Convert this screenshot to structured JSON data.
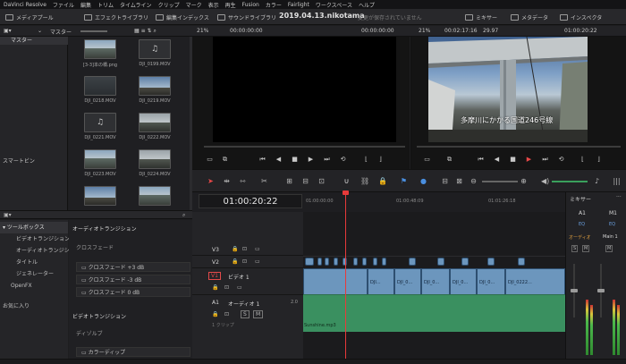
{
  "menu": [
    "DaVinci Resolve",
    "ファイル",
    "編集",
    "トリム",
    "タイムライン",
    "クリップ",
    "マーク",
    "表示",
    "再生",
    "Fusion",
    "カラー",
    "Fairlight",
    "ワークスペース",
    "ヘルプ"
  ],
  "toolbar": {
    "media_pool": "メディアプール",
    "effects_library": "エフェクトライブラリ",
    "edit_index": "編集インデックス",
    "sound_library": "サウンドライブラリ",
    "project_title": "2019.04.13.nikotama",
    "status": "変更が保存されていません",
    "mixer": "ミキサー",
    "metadata": "メタデータ",
    "inspector": "インスペクタ"
  },
  "bar2": {
    "bin": "マスター",
    "source_zoom": "21%",
    "source_tc": "00:00:00:00",
    "source_dur": "00:00:00:00",
    "tl_zoom": "21%",
    "tl_dur": "00:02:17:16",
    "fps": "29.97",
    "tl_tc": "01:00:20:22"
  },
  "bins": {
    "master": "マスター",
    "smart": "スマートビン"
  },
  "clips": [
    {
      "name": "[3-3]本の橋.png",
      "kind": "street"
    },
    {
      "name": "DJI_0199.MOV",
      "kind": "audio"
    },
    {
      "name": "DJI_0218.MOV",
      "kind": "dark"
    },
    {
      "name": "DJI_0219.MOV",
      "kind": "sky"
    },
    {
      "name": "DJI_0221.MOV",
      "kind": "audio"
    },
    {
      "name": "DJI_0222.MOV",
      "kind": "grey"
    },
    {
      "name": "DJI_0223.MOV",
      "kind": "street"
    },
    {
      "name": "DJI_0224.MOV",
      "kind": "grey"
    },
    {
      "name": "",
      "kind": "sky"
    },
    {
      "name": "",
      "kind": "street"
    }
  ],
  "viewer": {
    "caption": "多摩川にかかる国道246号線"
  },
  "fx_tree": {
    "toolbox": "ツールボックス",
    "items": [
      "ビデオトランジション",
      "オーディオトランジション",
      "タイトル",
      "ジェネレーター",
      "OpenFX"
    ],
    "favorites": "お気に入り"
  },
  "fx_list": {
    "audio_header": "オーディオトランジション",
    "crossfade_group": "クロスフェード",
    "crossfades": [
      "クロスフェード +3 dB",
      "クロスフェード -3 dB",
      "クロスフェード 0 dB"
    ],
    "video_header": "ビデオトランジション",
    "dissolve_group": "ディゾルブ",
    "dissolve_item": "カラーディップ"
  },
  "timeline": {
    "timecode": "01:00:20:22",
    "ruler": [
      "01:00:00:00",
      "01:00:48:09",
      "01:01:26:18"
    ],
    "tracks": {
      "v3": "V3",
      "v2": "V2",
      "v1": "V1",
      "v1_name": "ビデオ 1",
      "a1": "A1",
      "a1_name": "オーディオ 1",
      "a1_ch": "2.0",
      "a1_clips": "1 クリップ",
      "solo": "S",
      "mute": "M"
    },
    "v1_clips": [
      "DJI...",
      "DJI_0...",
      "DJI_0...",
      "DJI_0...",
      "DJI_0...",
      "DJI_0222..."
    ],
    "audio_clip": "Sunshine.mp3"
  },
  "mixer": {
    "title": "ミキサー",
    "ch1": "A1",
    "ch2": "M1",
    "ch1_name": "オーディオ",
    "ch2_name": "Main 1",
    "eq": "EQ",
    "solo": "S",
    "mute": "M"
  }
}
